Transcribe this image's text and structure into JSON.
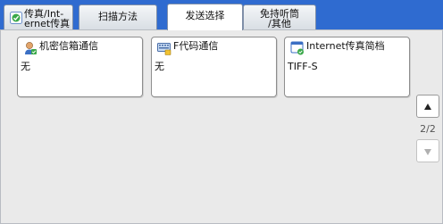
{
  "tabs": [
    {
      "label": "传真/Int-\nernet传真",
      "icon": "fax-icon"
    },
    {
      "label": "扫描方法"
    },
    {
      "label": "发送选择",
      "active": true
    },
    {
      "label": "免持听筒\n/其他"
    }
  ],
  "cards": [
    {
      "title": "机密信箱通信",
      "value": "无",
      "icon": "confidential-mailbox-icon"
    },
    {
      "title": "F代码通信",
      "value": "无",
      "icon": "f-code-icon"
    },
    {
      "title": "Internet传真简档",
      "value": "TIFF-S",
      "icon": "internet-fax-profile-icon"
    }
  ],
  "pagination": {
    "current_label": "2/2"
  },
  "colors": {
    "tab_bar": "#2f6bd0",
    "panel": "#eaeaea"
  }
}
